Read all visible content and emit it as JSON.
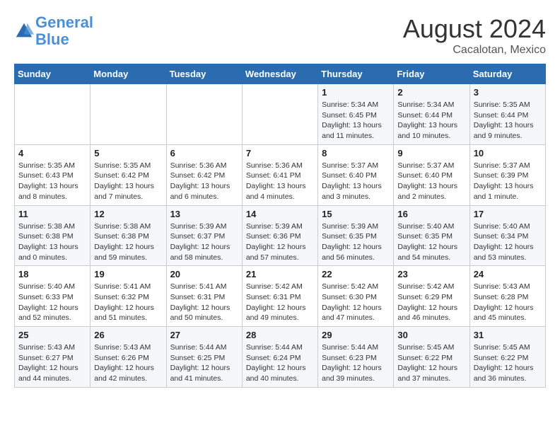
{
  "header": {
    "logo_line1": "General",
    "logo_line2": "Blue",
    "month_year": "August 2024",
    "location": "Cacalotan, Mexico"
  },
  "weekdays": [
    "Sunday",
    "Monday",
    "Tuesday",
    "Wednesday",
    "Thursday",
    "Friday",
    "Saturday"
  ],
  "weeks": [
    [
      {
        "day": "",
        "detail": ""
      },
      {
        "day": "",
        "detail": ""
      },
      {
        "day": "",
        "detail": ""
      },
      {
        "day": "",
        "detail": ""
      },
      {
        "day": "1",
        "detail": "Sunrise: 5:34 AM\nSunset: 6:45 PM\nDaylight: 13 hours\nand 11 minutes."
      },
      {
        "day": "2",
        "detail": "Sunrise: 5:34 AM\nSunset: 6:44 PM\nDaylight: 13 hours\nand 10 minutes."
      },
      {
        "day": "3",
        "detail": "Sunrise: 5:35 AM\nSunset: 6:44 PM\nDaylight: 13 hours\nand 9 minutes."
      }
    ],
    [
      {
        "day": "4",
        "detail": "Sunrise: 5:35 AM\nSunset: 6:43 PM\nDaylight: 13 hours\nand 8 minutes."
      },
      {
        "day": "5",
        "detail": "Sunrise: 5:35 AM\nSunset: 6:42 PM\nDaylight: 13 hours\nand 7 minutes."
      },
      {
        "day": "6",
        "detail": "Sunrise: 5:36 AM\nSunset: 6:42 PM\nDaylight: 13 hours\nand 6 minutes."
      },
      {
        "day": "7",
        "detail": "Sunrise: 5:36 AM\nSunset: 6:41 PM\nDaylight: 13 hours\nand 4 minutes."
      },
      {
        "day": "8",
        "detail": "Sunrise: 5:37 AM\nSunset: 6:40 PM\nDaylight: 13 hours\nand 3 minutes."
      },
      {
        "day": "9",
        "detail": "Sunrise: 5:37 AM\nSunset: 6:40 PM\nDaylight: 13 hours\nand 2 minutes."
      },
      {
        "day": "10",
        "detail": "Sunrise: 5:37 AM\nSunset: 6:39 PM\nDaylight: 13 hours\nand 1 minute."
      }
    ],
    [
      {
        "day": "11",
        "detail": "Sunrise: 5:38 AM\nSunset: 6:38 PM\nDaylight: 13 hours\nand 0 minutes."
      },
      {
        "day": "12",
        "detail": "Sunrise: 5:38 AM\nSunset: 6:38 PM\nDaylight: 12 hours\nand 59 minutes."
      },
      {
        "day": "13",
        "detail": "Sunrise: 5:39 AM\nSunset: 6:37 PM\nDaylight: 12 hours\nand 58 minutes."
      },
      {
        "day": "14",
        "detail": "Sunrise: 5:39 AM\nSunset: 6:36 PM\nDaylight: 12 hours\nand 57 minutes."
      },
      {
        "day": "15",
        "detail": "Sunrise: 5:39 AM\nSunset: 6:35 PM\nDaylight: 12 hours\nand 56 minutes."
      },
      {
        "day": "16",
        "detail": "Sunrise: 5:40 AM\nSunset: 6:35 PM\nDaylight: 12 hours\nand 54 minutes."
      },
      {
        "day": "17",
        "detail": "Sunrise: 5:40 AM\nSunset: 6:34 PM\nDaylight: 12 hours\nand 53 minutes."
      }
    ],
    [
      {
        "day": "18",
        "detail": "Sunrise: 5:40 AM\nSunset: 6:33 PM\nDaylight: 12 hours\nand 52 minutes."
      },
      {
        "day": "19",
        "detail": "Sunrise: 5:41 AM\nSunset: 6:32 PM\nDaylight: 12 hours\nand 51 minutes."
      },
      {
        "day": "20",
        "detail": "Sunrise: 5:41 AM\nSunset: 6:31 PM\nDaylight: 12 hours\nand 50 minutes."
      },
      {
        "day": "21",
        "detail": "Sunrise: 5:42 AM\nSunset: 6:31 PM\nDaylight: 12 hours\nand 49 minutes."
      },
      {
        "day": "22",
        "detail": "Sunrise: 5:42 AM\nSunset: 6:30 PM\nDaylight: 12 hours\nand 47 minutes."
      },
      {
        "day": "23",
        "detail": "Sunrise: 5:42 AM\nSunset: 6:29 PM\nDaylight: 12 hours\nand 46 minutes."
      },
      {
        "day": "24",
        "detail": "Sunrise: 5:43 AM\nSunset: 6:28 PM\nDaylight: 12 hours\nand 45 minutes."
      }
    ],
    [
      {
        "day": "25",
        "detail": "Sunrise: 5:43 AM\nSunset: 6:27 PM\nDaylight: 12 hours\nand 44 minutes."
      },
      {
        "day": "26",
        "detail": "Sunrise: 5:43 AM\nSunset: 6:26 PM\nDaylight: 12 hours\nand 42 minutes."
      },
      {
        "day": "27",
        "detail": "Sunrise: 5:44 AM\nSunset: 6:25 PM\nDaylight: 12 hours\nand 41 minutes."
      },
      {
        "day": "28",
        "detail": "Sunrise: 5:44 AM\nSunset: 6:24 PM\nDaylight: 12 hours\nand 40 minutes."
      },
      {
        "day": "29",
        "detail": "Sunrise: 5:44 AM\nSunset: 6:23 PM\nDaylight: 12 hours\nand 39 minutes."
      },
      {
        "day": "30",
        "detail": "Sunrise: 5:45 AM\nSunset: 6:22 PM\nDaylight: 12 hours\nand 37 minutes."
      },
      {
        "day": "31",
        "detail": "Sunrise: 5:45 AM\nSunset: 6:22 PM\nDaylight: 12 hours\nand 36 minutes."
      }
    ]
  ]
}
